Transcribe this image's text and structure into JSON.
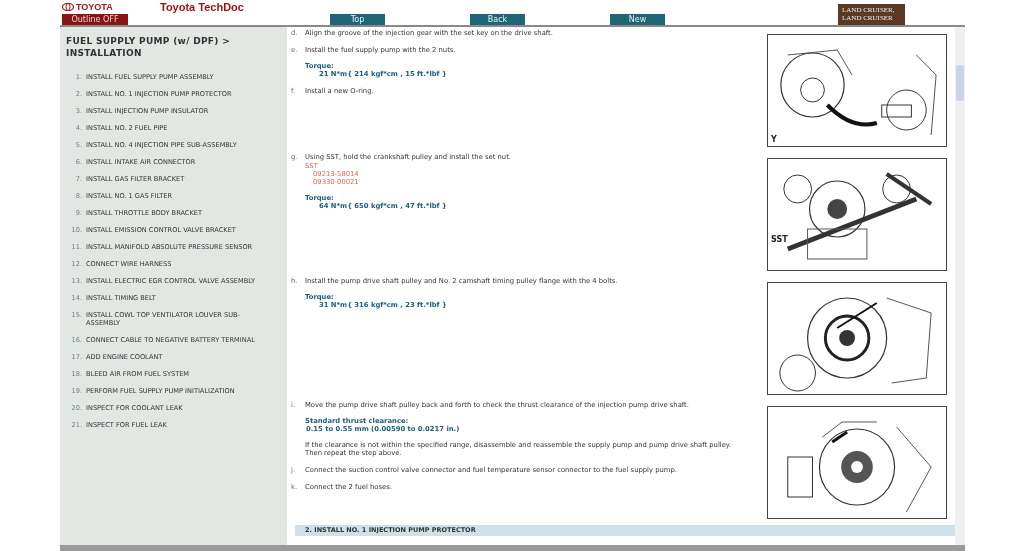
{
  "header": {
    "brand": "TOYOTA",
    "outline_button": "Outline OFF",
    "title": "Toyota TechDoc",
    "nav_buttons": [
      "Top",
      "Back",
      "New"
    ],
    "model_lines": [
      "LAND CRUISER,",
      "LAND CRUISER"
    ]
  },
  "sidebar": {
    "title": "FUEL SUPPLY PUMP (w/ DPF) > INSTALLATION",
    "items": [
      {
        "number": "1.",
        "label": "INSTALL FUEL SUPPLY PUMP ASSEMBLY"
      },
      {
        "number": "2.",
        "label": "INSTALL NO. 1 INJECTION PUMP PROTECTOR"
      },
      {
        "number": "3.",
        "label": "INSTALL INJECTION PUMP INSULATOR"
      },
      {
        "number": "4.",
        "label": "INSTALL NO. 2 FUEL PIPE"
      },
      {
        "number": "5.",
        "label": "INSTALL NO. 4 INJECTION PIPE SUB-ASSEMBLY"
      },
      {
        "number": "6.",
        "label": "INSTALL INTAKE AIR CONNECTOR"
      },
      {
        "number": "7.",
        "label": "INSTALL GAS FILTER BRACKET"
      },
      {
        "number": "8.",
        "label": "INSTALL NO. 1 GAS FILTER"
      },
      {
        "number": "9.",
        "label": "INSTALL THROTTLE BODY BRACKET"
      },
      {
        "number": "10.",
        "label": "INSTALL EMISSION CONTROL VALVE BRACKET"
      },
      {
        "number": "11.",
        "label": "INSTALL MANIFOLD ABSOLUTE PRESSURE SENSOR"
      },
      {
        "number": "12.",
        "label": "CONNECT WIRE HARNESS"
      },
      {
        "number": "13.",
        "label": "INSTALL ELECTRIC EGR CONTROL VALVE ASSEMBLY"
      },
      {
        "number": "14.",
        "label": "INSTALL TIMING BELT"
      },
      {
        "number": "15.",
        "label": "INSTALL COWL TOP VENTILATOR LOUVER SUB-ASSEMBLY"
      },
      {
        "number": "16.",
        "label": "CONNECT CABLE TO NEGATIVE BATTERY TERMINAL"
      },
      {
        "number": "17.",
        "label": "ADD ENGINE COOLANT"
      },
      {
        "number": "18.",
        "label": "BLEED AIR FROM FUEL SYSTEM"
      },
      {
        "number": "19.",
        "label": "PERFORM FUEL SUPPLY PUMP INITIALIZATION"
      },
      {
        "number": "20.",
        "label": "INSPECT FOR COOLANT LEAK"
      },
      {
        "number": "21.",
        "label": "INSPECT FOR FUEL LEAK"
      }
    ]
  },
  "content": {
    "blocks": [
      {
        "figure": {
          "label": "Y"
        },
        "steps": [
          {
            "letter": "d.",
            "text": "Align the groove of the injection gear with the set key on the drive shaft."
          },
          {
            "letter": "e.",
            "text": "Install the fuel supply pump with the 2 nuts.",
            "details": [
              {
                "kind": "spec",
                "label": "Torque:",
                "value": "21 N*m{ 214 kgf*cm , 15 ft.*lbf }"
              }
            ]
          },
          {
            "letter": "f.",
            "text": "Install a new O-ring."
          }
        ]
      },
      {
        "figure": {
          "label": "SST"
        },
        "steps": [
          {
            "letter": "g.",
            "text": "Using SST, hold the crankshaft pulley and install the set nut.",
            "details": [
              {
                "kind": "tool",
                "label": "SST",
                "codes": [
                  "09213-58014",
                  "09330-00021"
                ]
              },
              {
                "kind": "spec",
                "label": "Torque:",
                "value": "64 N*m{ 650 kgf*cm , 47 ft.*lbf }"
              }
            ]
          }
        ]
      },
      {
        "steps": [
          {
            "letter": "h.",
            "text": "Install the pump drive shaft pulley and No. 2 camshaft timing pulley flange with the 4 bolts.",
            "details": [
              {
                "kind": "spec",
                "label": "Torque:",
                "value": "31 N*m{ 316 kgf*cm , 23 ft.*lbf }"
              }
            ]
          }
        ]
      },
      {
        "steps": [
          {
            "letter": "i.",
            "text": "Move the pump drive shaft pulley back and forth to check the thrust clearance of the injection pump drive shaft.",
            "details": [
              {
                "kind": "spec",
                "label": "Standard thrust clearance:",
                "value": "0.15 to 0.55 mm (0.00590 to 0.0217 in.)"
              },
              {
                "kind": "note",
                "text": "If the clearance is not within the specified range, disassemble and reassemble the supply pump and pump drive shaft pulley. Then repeat the step above."
              }
            ]
          },
          {
            "letter": "j.",
            "text": "Connect the suction control valve connector and fuel temperature sensor connector to the fuel supply pump."
          },
          {
            "letter": "k.",
            "text": "Connect the 2 fuel hoses."
          }
        ]
      }
    ],
    "next_section": "2. INSTALL NO. 1 INJECTION PUMP PROTECTOR"
  }
}
